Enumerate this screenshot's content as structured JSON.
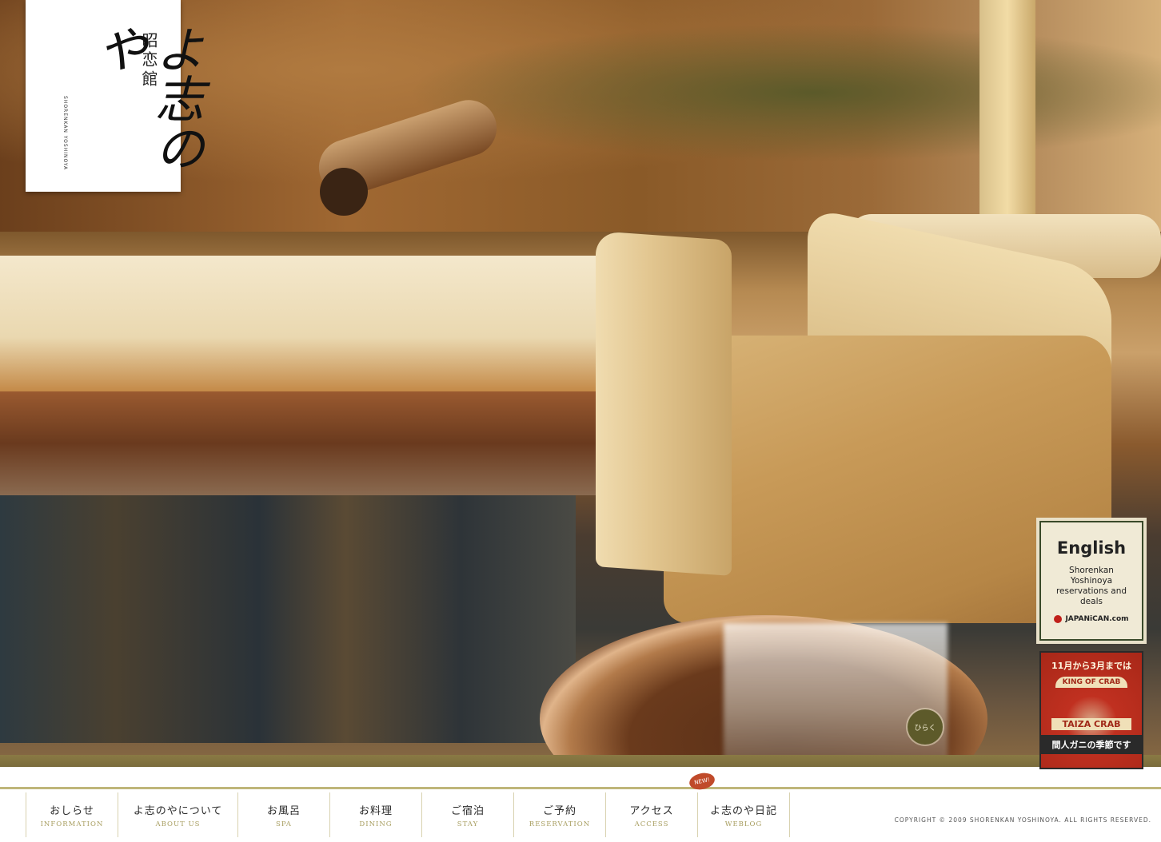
{
  "logo": {
    "kanji_small": "昭恋館",
    "kanji_main": "よ志のや",
    "roman": "SHORENKAN YOSHINOYA"
  },
  "english_badge": {
    "title": "English",
    "description": "Shorenkan Yoshinoya reservations and deals",
    "logo_text": "JAPANiCAN.com"
  },
  "crab_banner": {
    "top_text": "11月から3月までは",
    "king_text": "KING OF CRAB",
    "taiza_text": "TAIZA CRAB",
    "bottom_text": "間人ガニの季節です"
  },
  "hiraku_button": "ひらく",
  "nav": [
    {
      "jp": "おしらせ",
      "en": "INFORMATION"
    },
    {
      "jp": "よ志のやについて",
      "en": "ABOUT US"
    },
    {
      "jp": "お風呂",
      "en": "SPA"
    },
    {
      "jp": "お料理",
      "en": "DINING"
    },
    {
      "jp": "ご宿泊",
      "en": "STAY"
    },
    {
      "jp": "ご予約",
      "en": "RESERVATION"
    },
    {
      "jp": "アクセス",
      "en": "ACCESS"
    },
    {
      "jp": "よ志のや日記",
      "en": "WEBLOG"
    }
  ],
  "new_badge": "NEW!",
  "copyright": "COPYRIGHT © 2009 SHORENKAN YOSHINOYA. ALL RIGHTS RESERVED.",
  "colors": {
    "accent": "#bfb67a",
    "nav_en": "#a89e60",
    "badge_red": "#c03020"
  }
}
